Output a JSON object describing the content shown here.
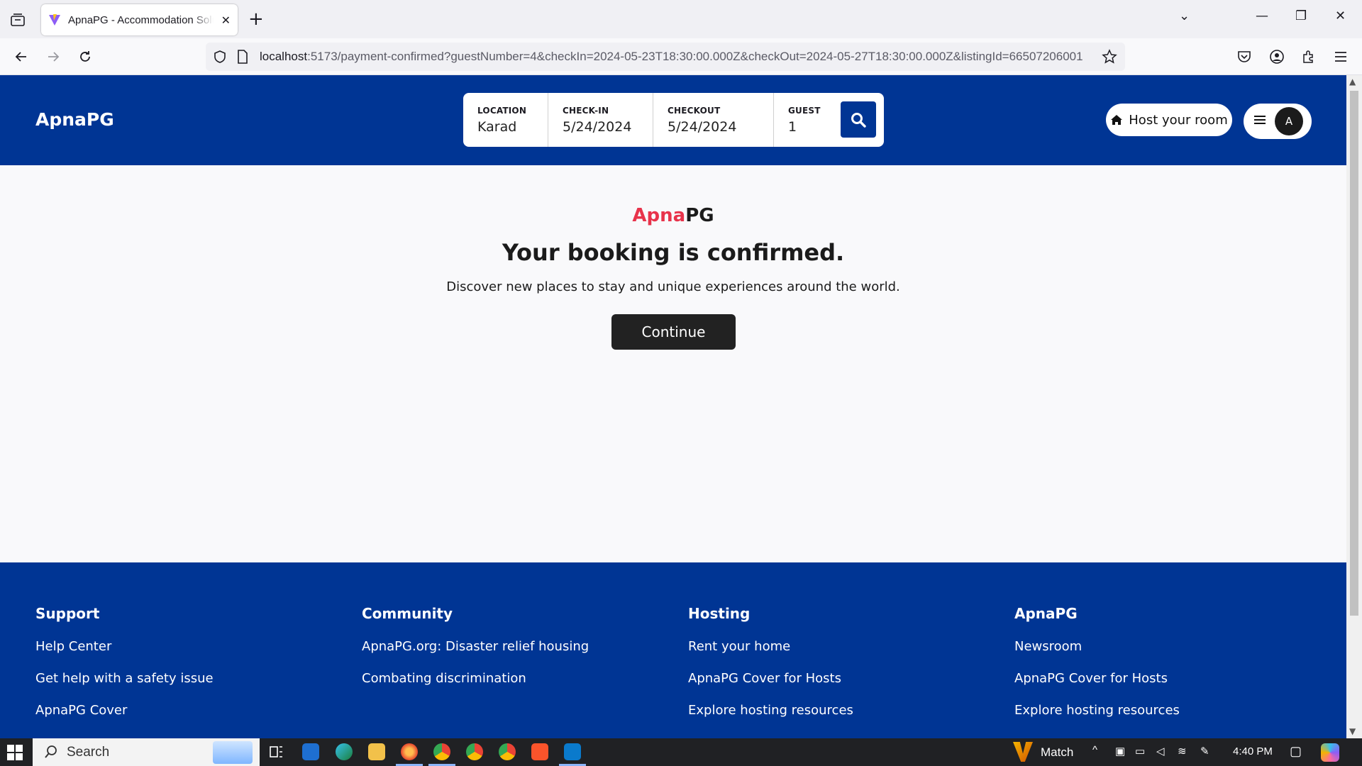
{
  "browser": {
    "tab_title": "ApnaPG - Accommodation Solutions",
    "url_host": "localhost",
    "url_rest": ":5173/payment-confirmed?guestNumber=4&checkIn=2024-05-23T18:30:00.000Z&checkOut=2024-05-27T18:30:00.000Z&listingId=66507206001"
  },
  "header": {
    "brand": "ApnaPG",
    "search": {
      "location_label": "LOCATION",
      "location_value": "Karad",
      "checkin_label": "CHECK-IN",
      "checkin_value": "5/24/2024",
      "checkout_label": "CHECKOUT",
      "checkout_value": "5/24/2024",
      "guest_label": "GUEST",
      "guest_value": "1"
    },
    "host_button": "Host your room",
    "avatar_initial": "A"
  },
  "main": {
    "logo_part1": "Apna",
    "logo_part2": "PG",
    "headline": "Your booking is confirmed.",
    "subline": "Discover new places to stay and unique experiences around the world.",
    "continue_label": "Continue"
  },
  "footer": {
    "columns": [
      {
        "title": "Support",
        "links": [
          "Help Center",
          "Get help with a safety issue",
          "ApnaPG Cover"
        ]
      },
      {
        "title": "Community",
        "links": [
          "ApnaPG.org: Disaster relief housing",
          "Combating discrimination"
        ]
      },
      {
        "title": "Hosting",
        "links": [
          "Rent your home",
          "ApnaPG Cover for Hosts",
          "Explore hosting resources"
        ]
      },
      {
        "title": "ApnaPG",
        "links": [
          "Newsroom",
          "ApnaPG Cover for Hosts",
          "Explore hosting resources"
        ]
      }
    ]
  },
  "taskbar": {
    "search_label": "Search",
    "weather_label": "Match",
    "time": "4:40 PM"
  },
  "colors": {
    "brand_blue": "#003594",
    "logo_red": "#e8334b",
    "button_dark": "#222222"
  }
}
